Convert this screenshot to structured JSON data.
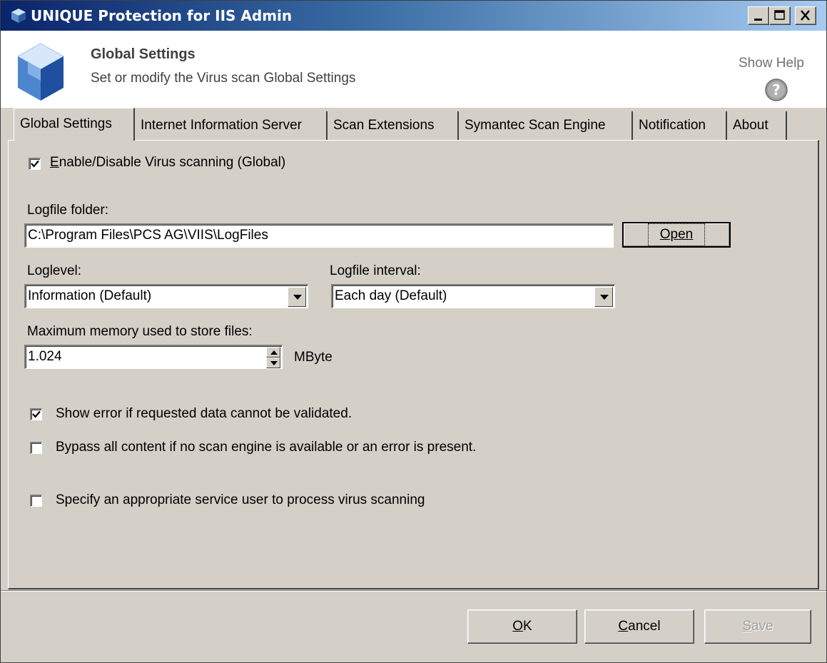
{
  "window": {
    "title": "UNIQUE Protection for IIS Admin"
  },
  "header": {
    "title": "Global Settings",
    "subtitle": "Set or modify the Virus scan Global Settings",
    "help_label": "Show Help"
  },
  "tabs": [
    {
      "label": "Global Settings",
      "active": true
    },
    {
      "label": "Internet Information Server",
      "active": false
    },
    {
      "label": "Scan Extensions",
      "active": false
    },
    {
      "label": "Symantec Scan Engine",
      "active": false
    },
    {
      "label": "Notification",
      "active": false
    },
    {
      "label": "About",
      "active": false
    }
  ],
  "global": {
    "enable_scanning": {
      "label_accel": "E",
      "label_rest": "nable/Disable Virus scanning (Global)",
      "checked": true
    },
    "logfile_folder": {
      "label": "Logfile folder:",
      "value": "C:\\Program Files\\PCS AG\\VIIS\\LogFiles",
      "open_button": "Open"
    },
    "loglevel": {
      "label": "Loglevel:",
      "selected": "Information (Default)"
    },
    "logfile_interval": {
      "label": "Logfile interval:",
      "selected": "Each day (Default)"
    },
    "max_memory": {
      "label": "Maximum memory used to store files:",
      "value": "1.024",
      "unit": "MByte"
    },
    "show_error": {
      "label": "Show error if requested data cannot be validated.",
      "checked": true
    },
    "bypass_content": {
      "label": "Bypass all content if no scan engine is available or an error is present.",
      "checked": false
    },
    "service_user": {
      "label": "Specify an appropriate service user to process virus scanning",
      "checked": false
    }
  },
  "footer": {
    "ok": {
      "accel": "O",
      "rest": "K"
    },
    "cancel": {
      "accel": "C",
      "rest": "ancel"
    },
    "save": {
      "accel": "S",
      "rest": "ave",
      "disabled": true
    }
  },
  "colors": {
    "title_gradient_start": "#0a246a",
    "title_gradient_end": "#a6caf0",
    "face": "#d4d0c8"
  },
  "icons": [
    "app-cube-icon",
    "minimize-icon",
    "maximize-icon",
    "close-icon",
    "help-icon",
    "dropdown-arrow-icon",
    "spin-up-icon",
    "spin-down-icon",
    "checkmark-icon"
  ]
}
